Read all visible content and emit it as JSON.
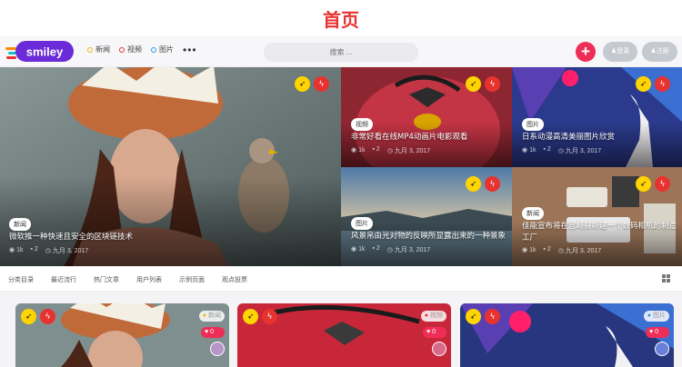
{
  "page_title": "首页",
  "header": {
    "logo_text": "smiley",
    "nav": [
      {
        "label": "新闻",
        "color": "#f4b400"
      },
      {
        "label": "视频",
        "color": "#e8322f"
      },
      {
        "label": "图片",
        "color": "#2e96e8"
      }
    ],
    "more_label": "•••",
    "search_placeholder": "搜索 ...",
    "plus_label": "+",
    "login_label": "登录",
    "register_label": "注册"
  },
  "hero": {
    "tiles": [
      {
        "tag": "新闻",
        "title": "微软推一种快速且安全的区块链技术",
        "views": "1k",
        "comments": "2",
        "date": "九月 3, 2017"
      },
      {
        "tag": "视频",
        "title": "非常好看在线MP4动画片电影观看",
        "views": "1k",
        "comments": "2",
        "date": "九月 3, 2017"
      },
      {
        "tag": "图片",
        "title": "日系动漫高清美丽图片欣赏",
        "views": "1k",
        "comments": "2",
        "date": "九月 3, 2017"
      },
      {
        "tag": "图片",
        "title": "风景帛由光对物的反映所显露出来的一种景象",
        "views": "1k",
        "comments": "2",
        "date": "九月 3, 2017"
      },
      {
        "tag": "新闻",
        "title": "佳能宣布将在宫崎县新建一个数码相机的制造工厂",
        "views": "1k",
        "comments": "2",
        "date": "九月 3, 2017"
      }
    ]
  },
  "categories": [
    "分类目录",
    "最近流行",
    "热门文章",
    "用户列表",
    "示例页面",
    "观点投票"
  ],
  "cards": [
    {
      "badge": "新闻",
      "likes": "0"
    },
    {
      "badge": "视频",
      "likes": "0"
    },
    {
      "badge": "图片",
      "likes": "0"
    }
  ],
  "icons": {
    "rocket": "rocket-icon",
    "bolt": "bolt-icon",
    "eye": "eye-icon",
    "comment": "comment-icon",
    "clock": "clock-icon",
    "heart": "heart-icon",
    "grid": "grid-view-icon"
  },
  "colors": {
    "accent_red": "#e8322f",
    "accent_pink": "#ef2e58",
    "accent_yellow": "#ffd400"
  }
}
